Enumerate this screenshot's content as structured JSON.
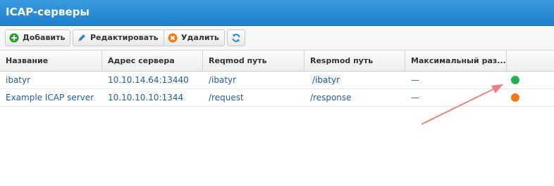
{
  "window": {
    "title": "ICAP-серверы"
  },
  "toolbar": {
    "add_label": "Добавить",
    "edit_label": "Редактировать",
    "delete_label": "Удалить"
  },
  "table": {
    "columns": [
      "Название",
      "Адрес сервера",
      "Reqmod путь",
      "Respmod путь",
      "Максимальный раз..."
    ],
    "rows": [
      {
        "name": "ibatyr",
        "address": "10.10.14.64:13440",
        "reqmod": "/ibatyr",
        "respmod": "/ibatyr",
        "max": "—",
        "status_color": "#22b14c"
      },
      {
        "name": "Example ICAP server",
        "address": "10.10.10.10:1344",
        "reqmod": "/request",
        "respmod": "/response",
        "max": "—",
        "status_color": "#f07b16"
      }
    ]
  },
  "colors": {
    "accent": "#1f7fcc",
    "arrow": "#f08080"
  },
  "icons": {
    "add": "plus-circle-icon",
    "edit": "pencil-icon",
    "delete": "close-circle-icon",
    "refresh": "refresh-icon"
  }
}
